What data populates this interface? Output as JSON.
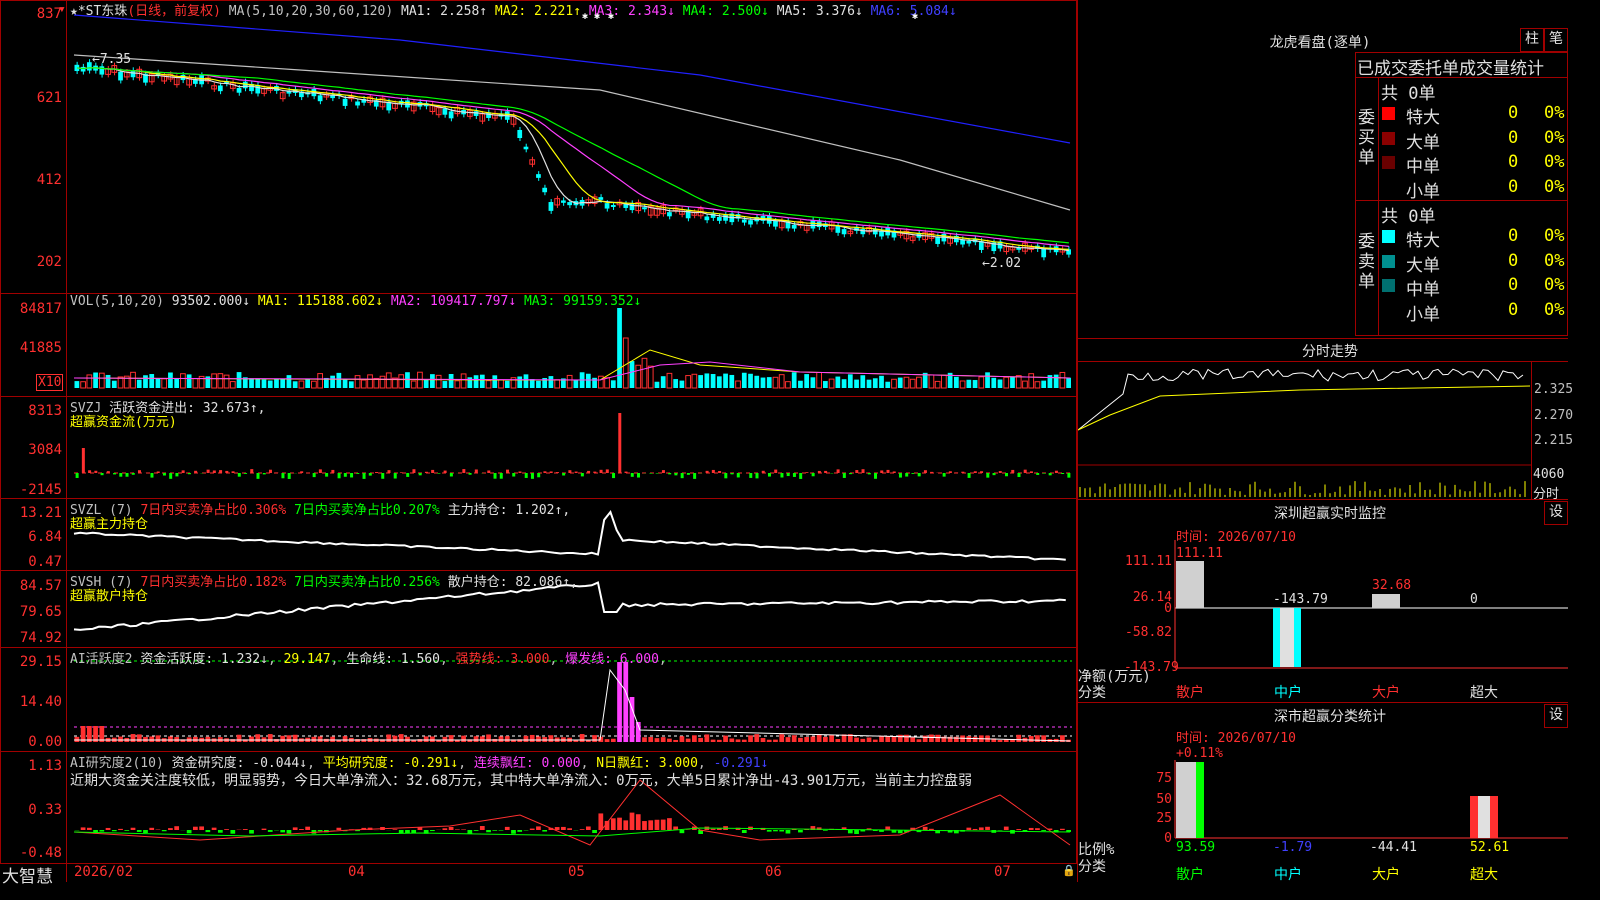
{
  "title_bar": {
    "stock_name": "★*ST东珠",
    "period": "(日线，前复权)",
    "ma_prefix": "MA(5,10,20,30,60,120)",
    "ma1": "MA1: 2.258↑",
    "ma2": "MA2: 2.221↑",
    "ma3": "MA3: 2.343↓",
    "ma4": "MA4: 2.500↓",
    "ma5": "MA5: 3.376↓",
    "ma6": "MA6: 5.084↓"
  },
  "price_axis": [
    "837",
    "621",
    "412",
    "202"
  ],
  "price_annotations": {
    "high": "←7.35",
    "low": "←2.02"
  },
  "vol": {
    "label": "VOL(5,10,20)",
    "value": "93502.000↓",
    "ma1": "MA1: 115188.602↓",
    "ma2": "MA2: 109417.797↓",
    "ma3": "MA3: 99159.352↓",
    "axis": [
      "84817",
      "41885"
    ],
    "unit": "X10"
  },
  "svzj": {
    "label": "SVZJ",
    "line1": "活跃资金进出: 32.673↑,",
    "line2": "超赢资金流(万元)",
    "axis": [
      "8313",
      "3084",
      "-2145"
    ]
  },
  "svzl": {
    "label": "SVZL (7)",
    "t1": "7日内买卖净占比0.306%",
    "t2": "7日内买卖净占比0.207%",
    "t3": "主力持仓: 1.202↑,",
    "line2": "超赢主力持仓",
    "axis": [
      "13.21",
      "6.84",
      "0.47"
    ]
  },
  "svsh": {
    "label": "SVSH (7)",
    "t1": "7日内买卖净占比0.182%",
    "t2": "7日内买卖净占比0.256%",
    "t3": "散户持仓: 82.086↑,",
    "line2": "超赢散户持仓",
    "axis": [
      "84.57",
      "79.65",
      "74.92"
    ]
  },
  "ai2": {
    "label": "AI活跃度2",
    "t1": "资金活跃度: 1.232↓",
    "t2": "29.147",
    "t3": "生命线: 1.560",
    "t4": "强势线: 3.000",
    "t5": "爆发线: 6.000",
    "axis": [
      "29.15",
      "14.40",
      "0.00"
    ]
  },
  "ai_research": {
    "label": "AI研究度2(10)",
    "t1": "资金研究度: -0.044↓",
    "t2": "平均研究度: -0.291↓",
    "t3": "连续飘红: 0.000",
    "t4": "N日飘红: 3.000",
    "t5": "-0.291↓",
    "commentary": "近期大资金关注度较低，明显弱势，今日大单净流入：32.68万元，其中特大单净流入：0万元，大单5日累计净出-43.901万元，当前主力控盘弱",
    "axis": [
      "1.13",
      "0.33",
      "-0.48"
    ]
  },
  "bottom_axis": {
    "brand": "大智慧",
    "months": [
      "2026/02",
      "04",
      "05",
      "06",
      "07"
    ]
  },
  "dragon_tiger": {
    "title": "龙虎看盘(逐单)",
    "btn_zhu": "柱",
    "btn_bi": "笔",
    "header": "已成交委托单成交量统计",
    "buy": {
      "side_label": "委买单",
      "total": "共 0单",
      "rows": [
        {
          "name": "特大",
          "count": "0",
          "pct": "0%",
          "color": "#ff0000"
        },
        {
          "name": "大单",
          "count": "0",
          "pct": "0%",
          "color": "#8b0000"
        },
        {
          "name": "中单",
          "count": "0",
          "pct": "0%",
          "color": "#6a0000"
        },
        {
          "name": "小单",
          "count": "0",
          "pct": "0%",
          "color": ""
        }
      ]
    },
    "sell": {
      "side_label": "委卖单",
      "total": "共 0单",
      "rows": [
        {
          "name": "特大",
          "count": "0",
          "pct": "0%",
          "color": "#00ffff"
        },
        {
          "name": "大单",
          "count": "0",
          "pct": "0%",
          "color": "#009090"
        },
        {
          "name": "中单",
          "count": "0",
          "pct": "0%",
          "color": "#007070"
        },
        {
          "name": "小单",
          "count": "0",
          "pct": "0%",
          "color": ""
        }
      ]
    }
  },
  "intraday": {
    "title": "分时走势",
    "axis": [
      "2.325",
      "2.270",
      "2.215"
    ],
    "vol_axis": "4060",
    "vol_unit": "分时"
  },
  "sz_monitor": {
    "title": "深圳超赢实时监控",
    "btn": "设",
    "time": "时间: 2026/07/10",
    "axis": [
      "111.11",
      "26.14",
      "0",
      "-58.82",
      "-143.79"
    ],
    "ylabel1": "净额(万元)",
    "ylabel2": "分类",
    "values": [
      "111.11",
      "-143.79",
      "32.68",
      "0"
    ],
    "categories": [
      "散户",
      "中户",
      "大户",
      "超大"
    ]
  },
  "sz_classify": {
    "title": "深市超赢分类统计",
    "btn": "设",
    "time": "时间: 2026/07/10",
    "top_value": "+0.11%",
    "axis": [
      "75",
      "50",
      "25",
      "0"
    ],
    "ylabel1": "比例%",
    "ylabel2": "分类",
    "values": [
      "93.59",
      "-1.79",
      "-44.41",
      "52.61"
    ],
    "categories": [
      "散户",
      "中户",
      "大户",
      "超大"
    ]
  }
}
